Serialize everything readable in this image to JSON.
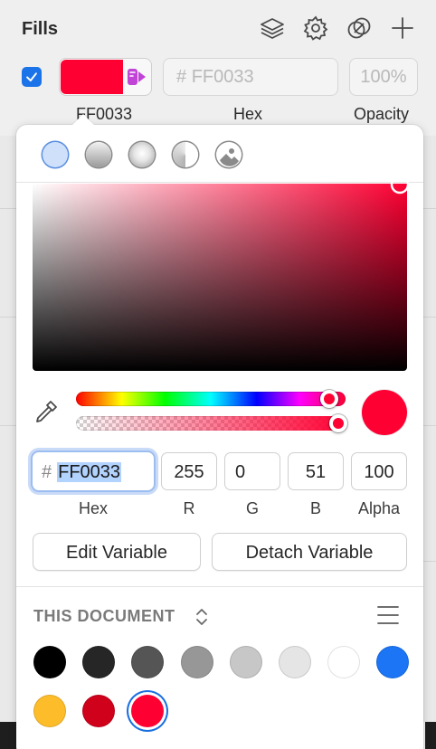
{
  "fills_panel": {
    "title": "Fills",
    "fill_enabled": true,
    "swatch_color": "#FF0033",
    "hex_value": "FF0033",
    "hex_placeholder_prefix": "#",
    "opacity": "100%",
    "labels": {
      "swatch": "FF0033",
      "hex": "Hex",
      "opacity": "Opacity"
    },
    "header_icons": [
      "layers-icon",
      "gear-icon",
      "overlap-circles-icon",
      "plus-icon"
    ]
  },
  "color_picker": {
    "modes": [
      "solid-fill",
      "linear-gradient",
      "radial-gradient",
      "angular-gradient",
      "image-fill"
    ],
    "selected_mode": "solid-fill",
    "current_color": "#FF0033",
    "hue_level": 0.96,
    "alpha_level": 1.0,
    "hex": {
      "prefix": "#",
      "value": "FF0033",
      "label": "Hex"
    },
    "r": {
      "value": "255",
      "label": "R"
    },
    "g": {
      "value": "0",
      "label": "G"
    },
    "b": {
      "value": "51",
      "label": "B"
    },
    "alpha": {
      "value": "100",
      "label": "Alpha"
    },
    "buttons": {
      "edit_variable": "Edit Variable",
      "detach_variable": "Detach Variable"
    },
    "document_colors": {
      "title": "THIS DOCUMENT",
      "swatches": [
        {
          "color": "#000000"
        },
        {
          "color": "#262626"
        },
        {
          "color": "#555555"
        },
        {
          "color": "#979797"
        },
        {
          "color": "#C7C7C7"
        },
        {
          "color": "#E5E5E5"
        },
        {
          "color": "#FFFFFF"
        },
        {
          "color": "#1B75F5"
        },
        {
          "color": "#FDBD2B"
        },
        {
          "color": "#D0011B"
        },
        {
          "color": "#FF0033",
          "selected": true
        }
      ]
    }
  }
}
